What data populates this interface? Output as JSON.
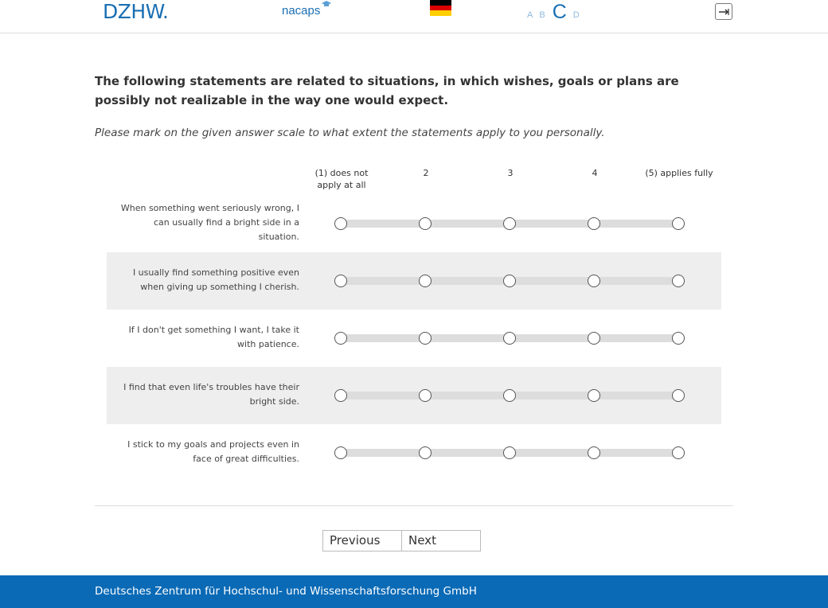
{
  "header": {
    "logo_dzhw": "DZHW.",
    "logo_nacaps": "nacaps",
    "flag_colors": [
      "#000000",
      "#dd0000",
      "#ffce00"
    ],
    "font_sizes": [
      "A",
      "B",
      "C",
      "D"
    ],
    "font_size_selected": "C",
    "logout_icon": "exit-arrow-icon"
  },
  "question": {
    "title": "The following statements are related to situations, in which wishes, goals or plans are possibly not realizable in the way one would expect.",
    "instruction": "Please mark on the given answer scale to what extent the statements apply to you personally."
  },
  "scale": {
    "labels": [
      "(1) does not apply at all",
      "2",
      "3",
      "4",
      "(5) applies fully"
    ]
  },
  "items": [
    {
      "label": "When something went seriously wrong, I can usually find a bright side in a situation.",
      "selected": null
    },
    {
      "label": "I usually find something positive even when giving up something I cherish.",
      "selected": null
    },
    {
      "label": "If I don't get something I want, I take it with patience.",
      "selected": null
    },
    {
      "label": "I find that even life's troubles have their bright side.",
      "selected": null
    },
    {
      "label": "I stick to my goals and projects even in face of great difficulties.",
      "selected": null
    }
  ],
  "navigation": {
    "previous_label": "Previous",
    "next_label": "Next"
  },
  "footer": {
    "text": "Deutsches Zentrum für Hochschul- und Wissenschaftsforschung GmbH"
  },
  "colors": {
    "brand_blue": "#0a6ab6",
    "row_shade": "#eeeeee",
    "track": "#dddddd"
  }
}
